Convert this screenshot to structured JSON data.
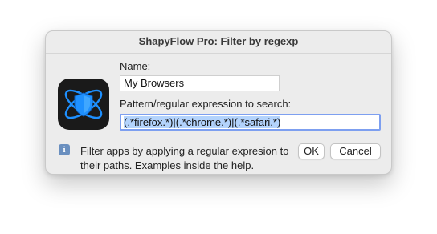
{
  "dialog": {
    "title": "ShapyFlow Pro: Filter by regexp",
    "name_label": "Name:",
    "name_value": "My Browsers",
    "pattern_label": "Pattern/regular expression to search:",
    "pattern_value": "(.*firefox.*)|(.*chrome.*)|(.*safari.*)",
    "info_icon": "info-icon",
    "help_text": "Filter apps by applying a regular expresion to their paths. Examples inside the help.",
    "ok_label": "OK",
    "cancel_label": "Cancel",
    "app_icon": "shapyflow-shield-atom-icon"
  },
  "colors": {
    "focus_ring": "#7d9ff0",
    "selection": "#b3d3fc",
    "icon_accent": "#1e90ff"
  }
}
